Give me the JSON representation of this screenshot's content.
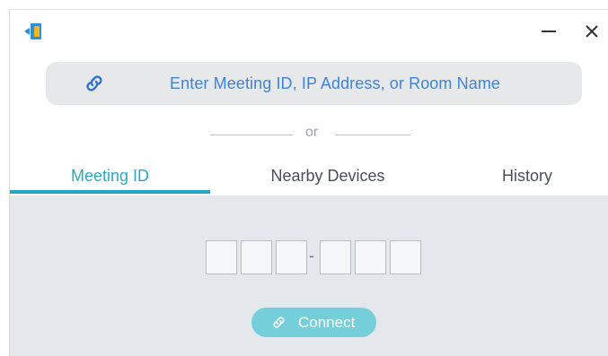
{
  "titlebar": {
    "app_icon": "app-logo-icon",
    "minimize_icon": "minimize-icon",
    "close_icon": "close-icon"
  },
  "search": {
    "icon": "link-icon",
    "placeholder": "Enter Meeting ID, IP Address, or Room Name"
  },
  "divider": {
    "text": "or"
  },
  "tabs": [
    {
      "label": "Meeting ID",
      "active": true
    },
    {
      "label": "Nearby Devices",
      "active": false
    },
    {
      "label": "History",
      "active": false
    }
  ],
  "meeting_id": {
    "boxes": [
      "",
      "",
      "",
      "",
      "",
      ""
    ],
    "separator": "-"
  },
  "connect": {
    "label": "Connect",
    "icon": "link-icon"
  },
  "colors": {
    "accent": "#1fa7c4",
    "search_text": "#3e84d6",
    "button_bg": "#74cfdb",
    "panel_bg": "#e4e8ec"
  }
}
